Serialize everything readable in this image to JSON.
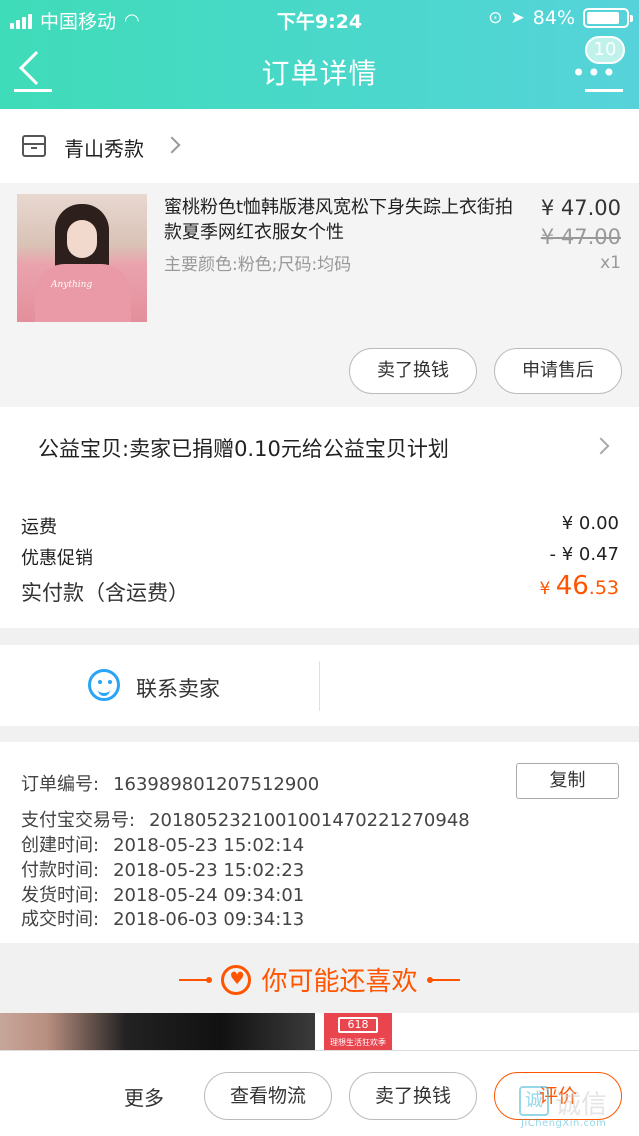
{
  "status_bar": {
    "carrier": "中国移动",
    "time": "下午9:24",
    "battery": "84%",
    "battery_level": 0.84
  },
  "nav": {
    "title": "订单详情",
    "badge": "10"
  },
  "shop": {
    "name": "青山秀款"
  },
  "item": {
    "title": "蜜桃粉色t恤韩版港风宽松下身失踪上衣街拍款夏季网红衣服女个性",
    "spec": "主要颜色:粉色;尺码:均码",
    "price": "¥ 47.00",
    "original_price": "¥ 47.00",
    "quantity": "x1",
    "thumb_text": "Anything"
  },
  "item_actions": {
    "sell": "卖了换钱",
    "after_sale": "申请售后"
  },
  "charity": {
    "text": "公益宝贝:卖家已捐赠0.10元给公益宝贝计划"
  },
  "fees": {
    "shipping_label": "运费",
    "shipping_value": "¥ 0.00",
    "discount_label": "优惠促销",
    "discount_value": "- ¥ 0.47",
    "paid_label": "实付款（含运费）",
    "paid_symbol": "¥ ",
    "paid_int": "46",
    "paid_dec": ".53"
  },
  "contact": {
    "label": "联系卖家"
  },
  "order": {
    "copy": "复制",
    "rows": [
      {
        "label": "订单编号:",
        "value": "163989801207512900"
      },
      {
        "label": "支付宝交易号:",
        "value": "2018052321001001470221270948"
      },
      {
        "label": "创建时间:",
        "value": "2018-05-23 15:02:14"
      },
      {
        "label": "付款时间:",
        "value": "2018-05-23 15:02:23"
      },
      {
        "label": "发货时间:",
        "value": "2018-05-24 09:34:01"
      },
      {
        "label": "成交时间:",
        "value": "2018-06-03 09:34:13"
      }
    ]
  },
  "recommend": {
    "title": "你可能还喜欢",
    "badge": "618",
    "badge_sub": "理想生活狂欢季"
  },
  "bottom": {
    "more": "更多",
    "logistics": "查看物流",
    "sell": "卖了换钱",
    "review": "评价"
  },
  "watermark": {
    "box": "诚",
    "text": "诚信",
    "sub": "JiChengXin.com"
  },
  "colors": {
    "header_start": "#3fdcb9",
    "header_end": "#56d3da",
    "accent_orange": "#ff5500",
    "chat_blue": "#2aa4f4"
  }
}
